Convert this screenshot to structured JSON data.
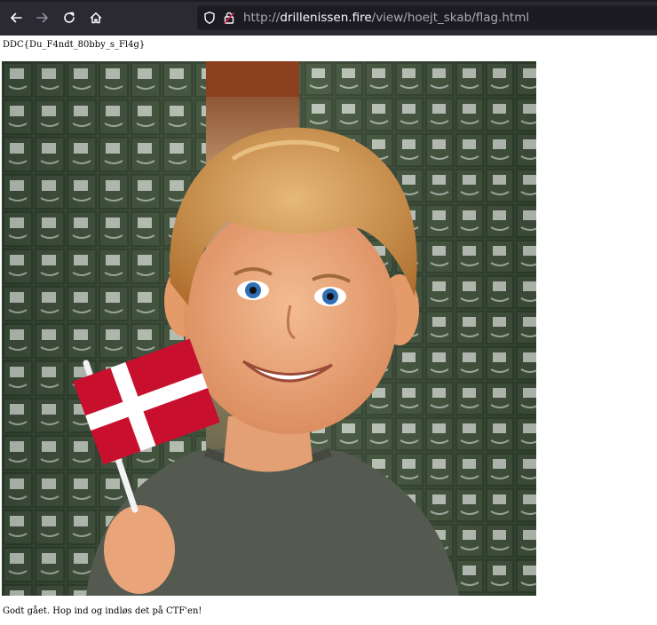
{
  "browser": {
    "url_prefix": "http://",
    "url_host": "drillenissen.fire",
    "url_path": "/view/hoejt_skab/flag.html"
  },
  "page": {
    "flag_text": "DDC{Du_F4ndt_80bby_s_Fl4g}",
    "caption": "Godt gået. Hop ind og indløs det på CTF'en!"
  },
  "image": {
    "subject": "smiling boy holding Danish flag in front of filing cabinets"
  },
  "colors": {
    "toolbar": "#2b2a33",
    "urlbar": "#1c1b22",
    "flag_red": "#c8102e"
  }
}
